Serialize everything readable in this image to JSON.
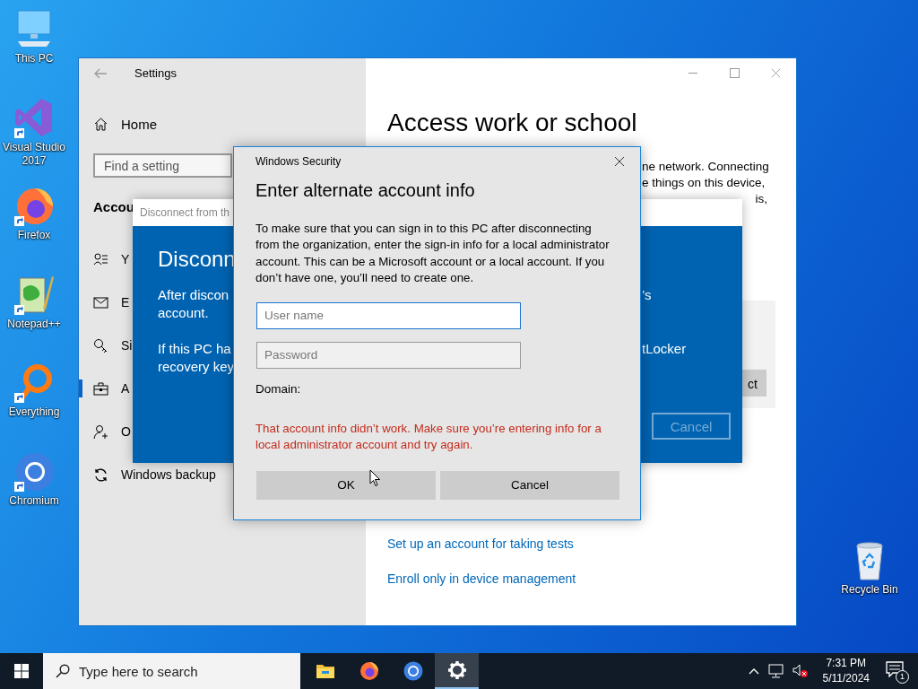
{
  "desktop_icons": [
    {
      "label": "This PC",
      "kind": "pc"
    },
    {
      "label": "Visual Studio 2017",
      "kind": "vs"
    },
    {
      "label": "Firefox",
      "kind": "firefox"
    },
    {
      "label": "Notepad++",
      "kind": "notepad"
    },
    {
      "label": "Everything",
      "kind": "everything"
    },
    {
      "label": "Chromium",
      "kind": "chromium"
    },
    {
      "label": "Recycle Bin",
      "kind": "bin"
    }
  ],
  "settings_window": {
    "title": "Settings",
    "home": "Home",
    "search_placeholder": "Find a setting",
    "section_heading": "Accou",
    "nav_items": [
      {
        "label": "Y",
        "kind": "person-list",
        "selected": false
      },
      {
        "label": "E",
        "kind": "mail",
        "selected": false
      },
      {
        "label": "Si",
        "kind": "key",
        "selected": false
      },
      {
        "label": "A",
        "kind": "briefcase",
        "selected": true
      },
      {
        "label": "O",
        "kind": "person-add",
        "selected": false
      },
      {
        "label": "Windows backup",
        "kind": "sync",
        "selected": false
      }
    ],
    "page_title": "Access work or school",
    "description_lines": [
      "ne network. Connecting",
      "e things on this device,",
      "is,"
    ],
    "button_fragment": "ct",
    "links": [
      "Set up an account for taking tests",
      "Enroll only in device management"
    ]
  },
  "disconnect_dialog": {
    "title": "Disconnect from th",
    "heading": "Disconn",
    "paragraph_1": [
      "After discon",
      "account."
    ],
    "paragraph_2": [
      "If this PC ha",
      "recovery key"
    ],
    "right_fragments": [
      "’s",
      "tLocker"
    ],
    "cancel": {
      "label": "Cancel",
      "disabled": true
    }
  },
  "security_dialog": {
    "title": "Windows Security",
    "heading": "Enter alternate account info",
    "message": "To make sure that you can sign in to this PC after disconnecting from the organization, enter the sign-in info for a local administrator account. This can be a Microsoft account or a local account. If you don’t have one, you’ll need to create one.",
    "fields": [
      {
        "placeholder": "User name",
        "focused": true
      },
      {
        "placeholder": "Password",
        "focused": false
      }
    ],
    "domain_label": "Domain:",
    "error": "That account info didn’t work. Make sure you’re entering info for a local administrator account and try again.",
    "buttons": [
      "OK",
      "Cancel"
    ]
  },
  "taskbar": {
    "search_placeholder": "Type here to search",
    "apps": [
      {
        "kind": "folder",
        "active": false
      },
      {
        "kind": "firefox",
        "active": false
      },
      {
        "kind": "chromium",
        "active": false
      },
      {
        "kind": "settings",
        "active": true
      }
    ],
    "time": "7:31 PM",
    "date": "5/11/2024",
    "notification_count": "1"
  }
}
